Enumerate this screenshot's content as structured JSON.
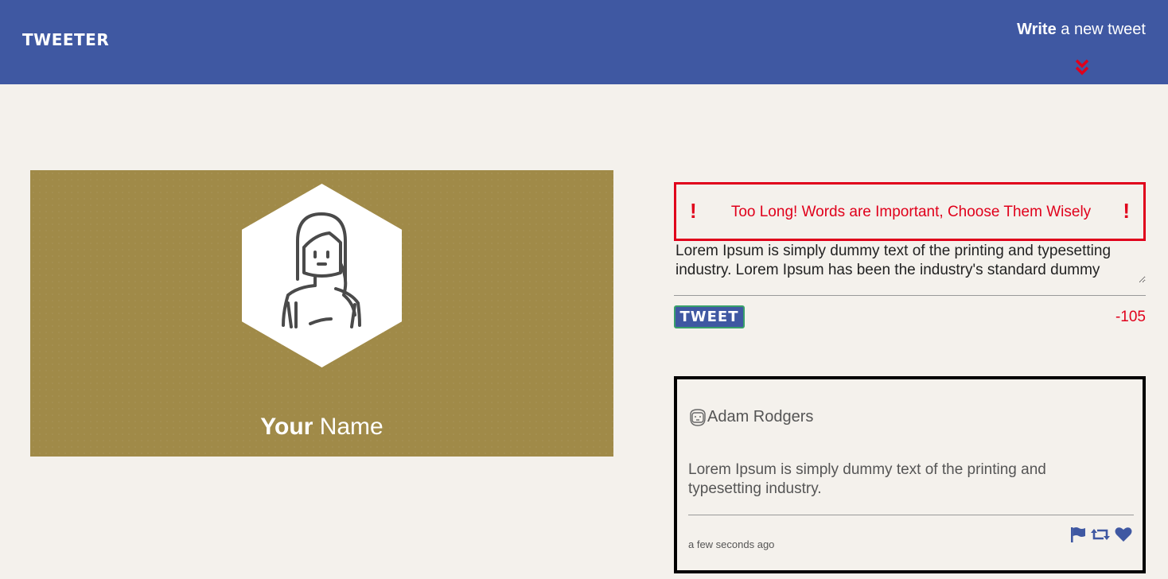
{
  "nav": {
    "brand": "TWEETER",
    "compose_bold": "Write",
    "compose_rest": " a new tweet",
    "chevron_icon": "double-chevron-down-icon"
  },
  "profile": {
    "name_bold": "Your",
    "name_rest": " Name",
    "avatar_icon": "person-avatar-icon",
    "background_color": "#a08a48"
  },
  "compose": {
    "error_message": "Too Long! Words are Important, Choose Them Wisely",
    "error_mark": "!",
    "text_value": "Lorem Ipsum is simply dummy text of the printing and typesetting industry. Lorem Ipsum has been the industry's standard dummy",
    "button_label": "TWEET",
    "char_counter": "-105"
  },
  "tweet": {
    "author": "Adam Rodgers",
    "body": "Lorem Ipsum is simply dummy text of the printing and typesetting industry.",
    "timestamp": "a few seconds ago",
    "actions": [
      "flag-icon",
      "retweet-icon",
      "heart-icon"
    ]
  },
  "colors": {
    "nav": "#3f58a2",
    "error": "#e0001b",
    "page": "#f4f1ec"
  }
}
